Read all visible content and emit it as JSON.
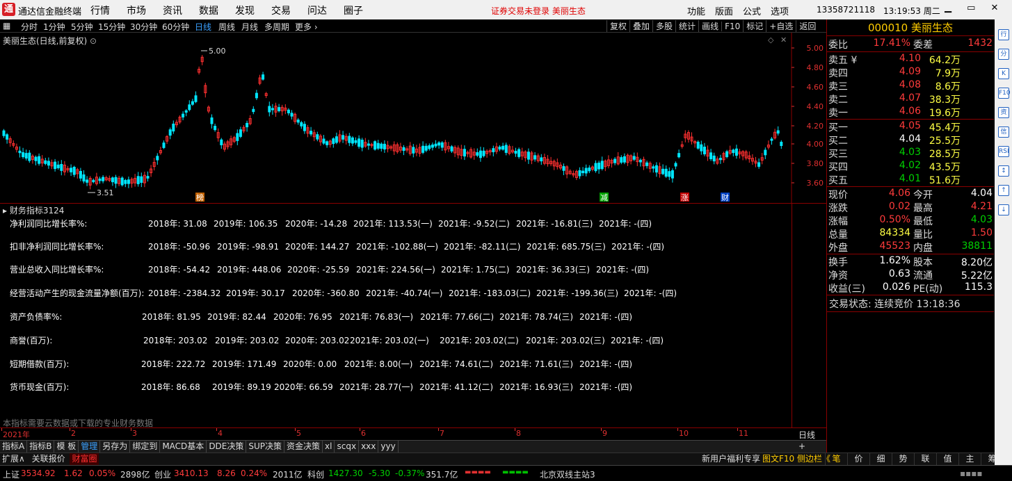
{
  "app": {
    "logo": "通",
    "title": "通达信金融终端",
    "menu": [
      "行情",
      "市场",
      "资讯",
      "数据",
      "发现",
      "交易",
      "问达",
      "圈子"
    ],
    "alert": "证券交易未登录  美丽生态",
    "rmenu": [
      "功能",
      "版面",
      "公式",
      "选项"
    ],
    "phone": "13358721118",
    "clock": "13:19:53 周二",
    "win": "▁ ▭ ✕"
  },
  "toolbar": {
    "periods": [
      "分时",
      "1分钟",
      "5分钟",
      "15分钟",
      "30分钟",
      "60分钟",
      "日线",
      "周线",
      "月线",
      "多周期",
      "更多 ›"
    ],
    "selected": "日线",
    "right": [
      "复权",
      "叠加",
      "多股",
      "统计",
      "画线",
      "F10",
      "标记",
      "+自选",
      "返回"
    ]
  },
  "kline": {
    "title": "美丽生态(日线,前复权)",
    "high_label": "5.00",
    "low_label": "3.51",
    "y_ticks": [
      "5.00",
      "4.80",
      "4.60",
      "4.40",
      "4.20",
      "4.00",
      "3.80",
      "3.60"
    ],
    "markers": [
      {
        "t": "榜",
        "c": "#c06000"
      },
      {
        "t": "减",
        "c": "#00a000"
      },
      {
        "t": "涨",
        "c": "#c00000"
      },
      {
        "t": "财",
        "c": "#0040c0"
      }
    ]
  },
  "fin": {
    "title": "财务指标3124",
    "rows": [
      {
        "label": "净利润同比增长率%:",
        "vals": [
          "2018年: 31.08",
          "2019年: 106.35",
          "2020年: -14.28",
          "2021年: 113.53(一)",
          "2021年: -9.52(二)",
          "2021年: -16.81(三)",
          "2021年: -(四)"
        ]
      },
      {
        "label": "扣非净利润同比增长率%:",
        "vals": [
          "2018年: -50.96",
          "2019年: -98.91",
          "2020年: 144.27",
          "2021年: -102.88(一)",
          "2021年: -82.11(二)",
          "2021年: 685.75(三)",
          "2021年: -(四)"
        ]
      },
      {
        "label": "营业总收入同比增长率%:",
        "vals": [
          "2018年: -54.42",
          "2019年: 448.06",
          "2020年: -25.59",
          "2021年: 224.56(一)",
          "2021年: 1.75(二)",
          "2021年: 36.33(三)",
          "2021年: -(四)"
        ]
      },
      {
        "label": "经营活动产生的现金流量净额(百万):",
        "vals": [
          "2018年: -2384.32",
          "2019年: 30.17",
          "2020年: -360.80",
          "2021年: -40.74(一)",
          "2021年: -183.03(二)",
          "2021年: -199.36(三)",
          "2021年: -(四)"
        ]
      },
      {
        "label": "资产负债率%:",
        "vals": [
          "2018年: 81.95",
          "2019年: 82.44",
          "2020年: 76.95",
          "2021年: 76.83(一)",
          "2021年: 77.66(二)",
          "2021年: 78.74(三)",
          "2021年: -(四)"
        ]
      },
      {
        "label": "商誉(百万):",
        "vals": [
          "2018年: 203.02",
          "2019年: 203.02",
          "2020年: 203.02",
          "2021年: 203.02(一)",
          "2021年: 203.02(二)",
          "2021年: 203.02(三)",
          "2021年: -(四)"
        ]
      },
      {
        "label": "短期借款(百万):",
        "vals": [
          "2018年: 222.72",
          "2019年: 171.49",
          "2020年: 0.00",
          "2021年: 8.00(一)",
          "2021年: 74.61(二)",
          "2021年: 71.61(三)",
          "2021年: -(四)"
        ]
      },
      {
        "label": "货币现金(百万):",
        "vals": [
          "2018年: 86.68",
          "2019年: 89.19",
          "2020年: 66.59",
          "2021年: 28.77(一)",
          "2021年: 41.12(二)",
          "2021年: 16.93(三)",
          "2021年: -(四)"
        ]
      }
    ],
    "note": "本指标需要云数据或下载的专业财务数据"
  },
  "timeaxis": {
    "months": [
      "2021年",
      "2",
      "3",
      "4",
      "5",
      "6",
      "7",
      "8",
      "9",
      "10",
      "11"
    ],
    "label": "日线"
  },
  "tabs": [
    "指标A",
    "指标B",
    "模 板",
    "管理",
    "另存为",
    "绑定到",
    "MACD基本",
    "DDE决策",
    "SUP决策",
    "资金决策",
    "xl",
    "scqx",
    "xxx",
    "yyy"
  ],
  "tabs_active": "管理",
  "tabs_pm": "+ −",
  "tabs2": {
    "left": [
      "扩展∧",
      "关联报价",
      "财富圈"
    ],
    "news_a": "新用户福利专享 ",
    "news_b": "图文F10",
    "news_c": " 侧边栏《",
    "right": [
      "笔",
      "价",
      "细",
      "势",
      "联",
      "值",
      "主",
      "筹"
    ]
  },
  "status": {
    "sh_name": "上证",
    "sh_val": "3534.92",
    "sh_chg": "1.62",
    "sh_pct": "0.05%",
    "sh_amt": "2898亿",
    "cy_name": "创业",
    "cy_val": "3410.13",
    "cy_chg": "8.26",
    "cy_pct": "0.24%",
    "cy_amt": "2011亿",
    "kc_name": "科创",
    "kc_val": "1427.30",
    "kc_chg": "-5.30",
    "kc_pct": "-0.37%",
    "kc_amt": "351.7亿",
    "server": "北京双线主站3"
  },
  "quote": {
    "code": "000010",
    "name": "美丽生态",
    "wb_label": "委比",
    "wb": "17.41%",
    "wc_label": "委差",
    "wc": "1432",
    "sell": [
      {
        "l": "卖五 ¥",
        "p": "4.10",
        "v": "64.2万"
      },
      {
        "l": "卖四",
        "p": "4.09",
        "v": "7.9万"
      },
      {
        "l": "卖三",
        "p": "4.08",
        "v": "8.6万"
      },
      {
        "l": "卖二",
        "p": "4.07",
        "v": "38.3万"
      },
      {
        "l": "卖一",
        "p": "4.06",
        "v": "19.6万"
      }
    ],
    "buy": [
      {
        "l": "买一",
        "p": "4.05",
        "v": "45.4万"
      },
      {
        "l": "买二",
        "p": "4.04",
        "v": "25.5万"
      },
      {
        "l": "买三",
        "p": "4.03",
        "v": "28.5万"
      },
      {
        "l": "买四",
        "p": "4.02",
        "v": "43.5万"
      },
      {
        "l": "买五",
        "p": "4.01",
        "v": "51.6万"
      }
    ],
    "stats": [
      {
        "a": "现价",
        "av": "4.06",
        "ac": "red",
        "b": "今开",
        "bv": "4.04",
        "bc": "wht"
      },
      {
        "a": "涨跌",
        "av": "0.02",
        "ac": "red",
        "b": "最高",
        "bv": "4.21",
        "bc": "red"
      },
      {
        "a": "涨幅",
        "av": "0.50%",
        "ac": "red",
        "b": "最低",
        "bv": "4.03",
        "bc": "grn"
      },
      {
        "a": "总量",
        "av": "84334",
        "ac": "yel",
        "b": "量比",
        "bv": "1.50",
        "bc": "red"
      },
      {
        "a": "外盘",
        "av": "45523",
        "ac": "red",
        "b": "内盘",
        "bv": "38811",
        "bc": "grn"
      }
    ],
    "stats2": [
      {
        "a": "换手",
        "av": "1.62%",
        "b": "股本",
        "bv": "8.20亿"
      },
      {
        "a": "净资",
        "av": "0.63",
        "b": "流通",
        "bv": "5.22亿"
      },
      {
        "a": "收益(三)",
        "av": "0.026",
        "b": "PE(动)",
        "bv": "115.3"
      }
    ],
    "state": "交易状态: 连续竞价 13:18:36"
  },
  "sidebar": [
    "行",
    "分",
    "K",
    "F10",
    "资",
    "信",
    "RSI",
    "↕",
    "↑",
    "↓"
  ]
}
